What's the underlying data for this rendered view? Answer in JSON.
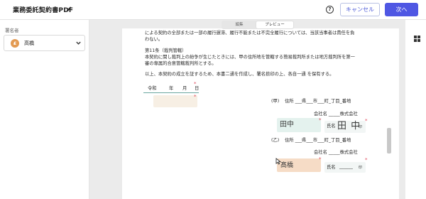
{
  "header": {
    "title": "業務委託契約書PDF",
    "help_symbol": "?",
    "cancel_label": "キャンセル",
    "next_label": "次へ",
    "primary_color": "#4f57e3"
  },
  "mode_toggle": {
    "edit_label": "編集",
    "preview_label": "プレビュー",
    "selected": "プレビュー"
  },
  "sidebar": {
    "signer_label": "署名者",
    "signer_avatar": "₤",
    "signer_name": "高橋",
    "signer_color": "#e39a52"
  },
  "document": {
    "line1": "による契約の全部または一部の履行遅滞、履行不能または不完全履行については、当該当事者は責任を負",
    "line2": "わない。",
    "article_title": "第11条（裁判管轄）",
    "article_body1": "本契約に関し裁判上の紛争が生じたときには、甲の住所地を管轄する簡易裁判所または地方裁判所を第一",
    "article_body2": "審の専属的合意管轄裁判所とする。",
    "closing": "以上、本契約の成立を証するため、本書二通を作成し、署名捺印の上、各自一通 を保有する。",
    "date_era": "令和",
    "date_year": "年",
    "date_month": "月",
    "date_day": "日",
    "required_mark": "*",
    "party_a": {
      "label": "(甲)",
      "address": "住所 ___県___市___町_丁目_番地",
      "company": "会社名 _____株式会社",
      "name_label": "氏名",
      "seal": "印",
      "signature_text": "田中",
      "name_handwritten": "田 中"
    },
    "party_b": {
      "label": "(乙)",
      "address": "住所 ___県___市___町_丁目_番地",
      "company": "会社名 _____株式会社",
      "name_label": "氏名",
      "name_line": "______",
      "seal": "印",
      "signature_text": "髙橋"
    }
  },
  "icons": [
    "pencil-icon",
    "help-icon",
    "chevron-down-icon",
    "grid-view-icon",
    "cursor-icon"
  ]
}
